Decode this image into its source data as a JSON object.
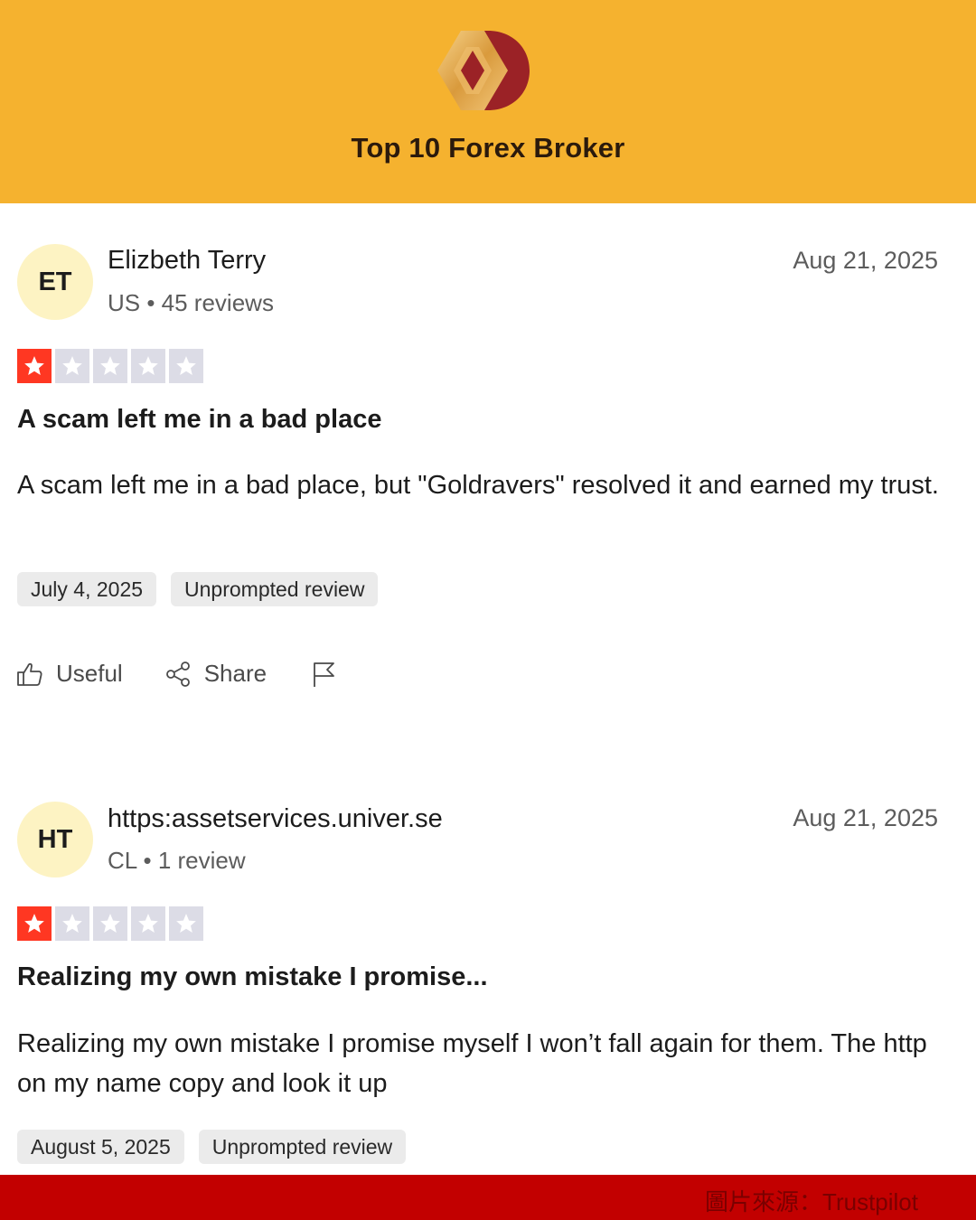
{
  "header": {
    "title": "Top 10 Forex Broker",
    "logo_icon": "diamond-chevron-logo",
    "background": "#f5b22f"
  },
  "reviews": [
    {
      "initials": "ET",
      "name": "Elizbeth Terry",
      "meta": "US • 45 reviews",
      "date": "Aug 21, 2025",
      "rating": 1,
      "max_rating": 5,
      "title": "A scam left me in a bad place",
      "body": "A scam left me in a bad place, but \"Goldravers\" resolved it and earned my trust.",
      "experience_date": "July 4, 2025",
      "tag": "Unprompted review",
      "actions": {
        "useful": "Useful",
        "share": "Share"
      }
    },
    {
      "initials": "HT",
      "name": "https:assetservices.univer.se",
      "meta": "CL • 1 review",
      "date": "Aug 21, 2025",
      "rating": 1,
      "max_rating": 5,
      "title": "Realizing my own mistake I promise...",
      "body": "Realizing my own mistake I promise myself I won’t fall again for them. The http on my name copy and look it up",
      "experience_date": "August 5, 2025",
      "tag": "Unprompted review"
    }
  ],
  "footer": {
    "credit": "圖片來源：Trustpilot",
    "background": "#c20000"
  },
  "colors": {
    "star_on": "#ff3722",
    "star_off": "#dcdce6",
    "avatar_bg": "#fdf3c3"
  }
}
